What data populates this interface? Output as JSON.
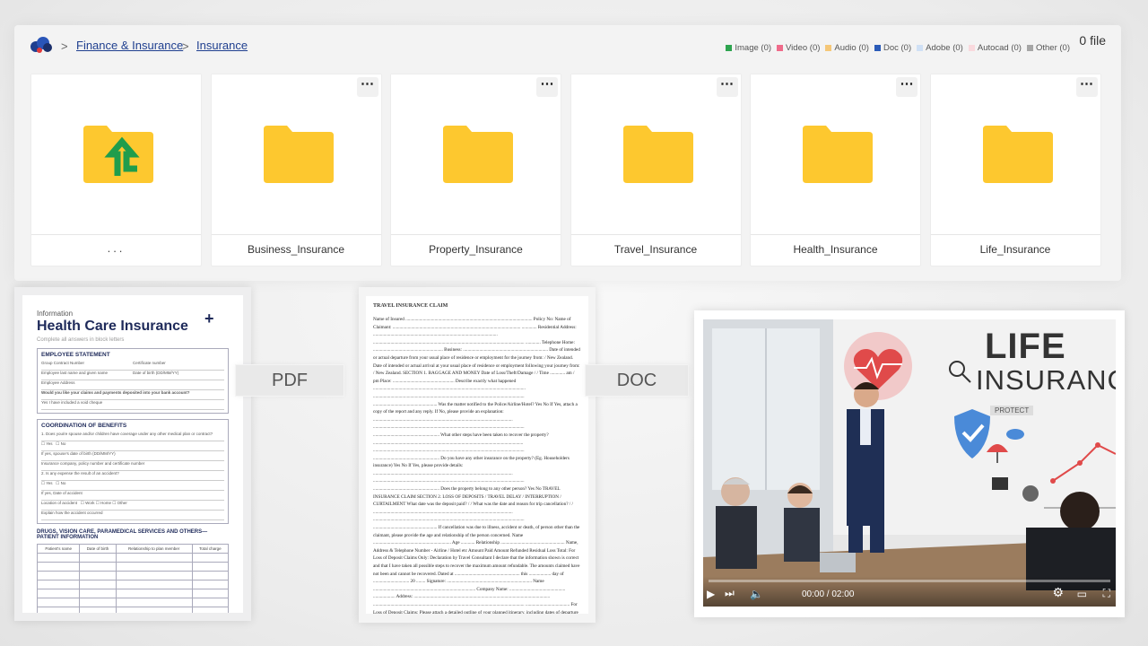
{
  "breadcrumb": {
    "separator": ">",
    "items": [
      "Finance & Insurance",
      "Insurance"
    ]
  },
  "file_count": "0 file",
  "legend": [
    {
      "label": "Image (0)",
      "color": "#2ea44f"
    },
    {
      "label": "Video (0)",
      "color": "#ef6b8a"
    },
    {
      "label": "Audio (0)",
      "color": "#f5c778"
    },
    {
      "label": "Doc (0)",
      "color": "#2b5bb8"
    },
    {
      "label": "Adobe (0)",
      "color": "#cfe0f5"
    },
    {
      "label": "Autocad (0)",
      "color": "#f9d9dd"
    },
    {
      "label": "Other (0)",
      "color": "#a6a6a6"
    }
  ],
  "tiles": {
    "parent": {
      "label": "..."
    },
    "folders": [
      "Business_Insurance",
      "Property_Insurance",
      "Travel_Insurance",
      "Health_Insurance",
      "Life_Insurance"
    ],
    "menu_icon": "more-horizontal-icon",
    "folder_color": "#fdc82f",
    "up_arrow_color": "#1f9d4c"
  },
  "pdf_preview": {
    "kicker": "Information",
    "title": "Health Care Insurance",
    "subtitle": "Complete all answers in block letters",
    "section1": "EMPLOYEE STATEMENT",
    "section1_fields": [
      "Group Contract Number",
      "Certificate number",
      "Employee last name and given name",
      "Date of birth (DD/MM/YY)",
      "Employee Address"
    ],
    "section1_question": "Would you like your claims and payments deposited into your bank account?",
    "section1_option": "Yes   I have included a void cheque",
    "section2": "COORDINATION OF BENEFITS",
    "section2_q1": "1. Does you/re spouse and/or children have coverage under any other medical plan or contract?",
    "yes": "Yes",
    "no": "No",
    "section2_f1": "If yes, spouse's date of birth (DD/MM/YY)",
    "section2_f2": "Insurance company, policy number and certificate number",
    "section2_q2": "2. Is any expense the result of an accident?",
    "section2_f3": "If yes, Date of accident",
    "section2_f4": "Location of accident",
    "loc_options": [
      "Work",
      "Home",
      "Other"
    ],
    "section2_f5": "Explain how the accident occurred",
    "section3": "DRUGS, VISION CARE, PARAMEDICAL SERVICES AND OTHERS—PATIENT INFORMATION",
    "table_headers": [
      "Patient's name",
      "Date of birth",
      "Relationship to plan member",
      "Total charge"
    ]
  },
  "pdf_chip": "PDF",
  "doc_chip": "DOC",
  "doc_preview": {
    "title": "TRAVEL INSURANCE CLAIM",
    "body": "Name of Insured ............................................................................................................. Policy No: Name of Claimant: .............................................................................................................. ............. Residential Address: ........................................................................................................... .................................................................................................................................. ............. Telephone Home: ............................................................ Business: ......................................................................... Date of intended or actual departure from your usual place of residence or employment for the journey from: / New Zealand. Date of intended or actual arrival at your usual place of residence or employment following your journey from: / New Zealand. SECTION 1. BAGGAGE AND MONEY Date of Loss/Theft/Damage / / Time ............. am / pm Place: ..................................................... Describe exactly what happened ................................................................................................................................... .................................................................................................................................. ....................................................... Was the matter notified to the Police/Airline/Hotel? Yes No If Yes, attach a copy of the report and any reply. If No, please provide an explanation: ........................................................................................................................ .................................................................................................................................. ......................................................... What other steps have been taken to recover the property? ................................................................................................................................. .................................................................................................................................. ......................................................... Do you have any other insurance on the property? (Eg. Householders insurance) Yes No If Yes, please provide details: ........................................................................................................................ .................................................................................................................................. ......................................................... Does the property belong to any other person? Yes No TRAVEL INSURANCE CLAIM SECTION 2. LOSS OF DEPOSITS / TRAVEL DELAY / INTERRUPTION / CURTAILMENT What date was the deposit paid? / / What was the date and reason for trip cancellation? / / ........................................................................................................................ .................................................................................................................................. ....................................................... If cancellation was due to illness, accident or death, of person other than the claimant, please provide the age and relationship of the person concerned. Name ................................................................... Age ............ Relationship ....................................................... Name, Address & Telephone Number - Airline / Hotel etc Amount Paid Amount Refunded Residual Loss Total: For Loss of Deposit Claims Only: Declaration by Travel Consultant I declare that the information shown is correct and that I have taken all possible steps to recover the maximum amount refundable. The amounts claimed have not been and cannot be recovered. Dated at ........................................................ this ................... day of ............................... 20 ........ Signature: ......................................................................... Name ........................................................................................ Company Name: ................................................ ................... Address: ..................................................................................................................... .................................................................................................................................. ...................................... For Loss of Deposit Claims: Please attach a detailed outline of your planned itinerary, including dates of departure and return. For Other Claims: Attach all available documents,"
  },
  "video": {
    "word1": "LIFE",
    "word2": "INSURANCE",
    "tag": "PROTECT",
    "time_current": "00:00",
    "time_total": "02:00",
    "time_display": "00:00 / 02:00",
    "progress": 0.0
  }
}
